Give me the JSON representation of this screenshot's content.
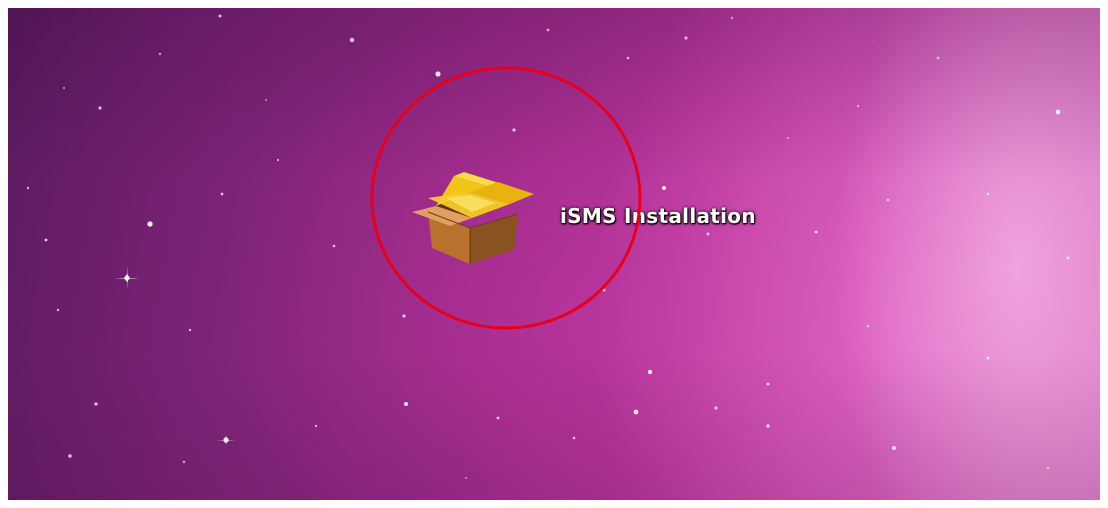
{
  "desktop": {
    "wallpaper": "purple-pink-starfield",
    "colors": {
      "dark_purple": "#5a1a5e",
      "magenta": "#b5359b",
      "pink_light": "#d977c4",
      "highlight_circle": "#e8001a"
    },
    "icons": [
      {
        "label": "iSMS Installation",
        "icon": "package-box-icon",
        "highlighted": true
      }
    ]
  }
}
